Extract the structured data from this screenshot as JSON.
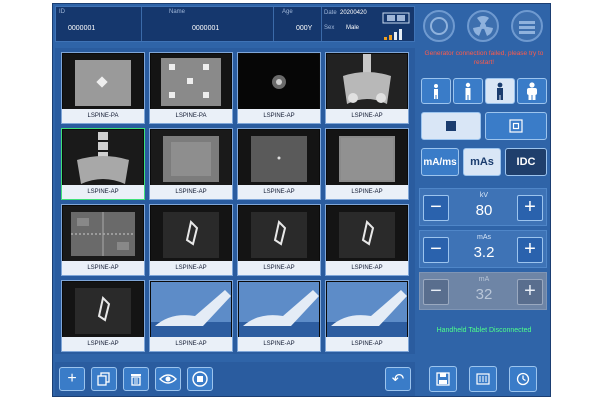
{
  "header": {
    "id_label": "ID",
    "id_value": "0000001",
    "name_label": "Name",
    "name_value": "0000001",
    "age_label": "Age",
    "age_value": "000Y",
    "date_label": "Date",
    "date_value": "20200420",
    "sex_label": "Sex",
    "sex_value": "Male"
  },
  "thumbnails": [
    {
      "caption": "LSPINE-PA"
    },
    {
      "caption": "LSPINE-PA"
    },
    {
      "caption": "LSPINE-AP"
    },
    {
      "caption": "LSPINE-AP"
    },
    {
      "caption": "LSPINE-AP"
    },
    {
      "caption": "LSPINE-AP"
    },
    {
      "caption": "LSPINE-AP"
    },
    {
      "caption": "LSPINE-AP"
    },
    {
      "caption": "LSPINE-AP"
    },
    {
      "caption": "LSPINE-AP"
    },
    {
      "caption": "LSPINE-AP"
    },
    {
      "caption": "LSPINE-AP"
    },
    {
      "caption": "LSPINE-AP"
    },
    {
      "caption": "LSPINE-AP"
    },
    {
      "caption": "LSPINE-AP"
    },
    {
      "caption": "LSPINE-AP"
    }
  ],
  "status": {
    "generator_error": "Generator connection failed, please try to restart!",
    "tablet": "Handheld Tablet Disconnected"
  },
  "mode_buttons": {
    "mams_label": "mA/ms",
    "mas_label": "mAs",
    "idc_label": "IDC"
  },
  "controls": {
    "kv": {
      "label": "kV",
      "value": "80"
    },
    "mas": {
      "label": "mAs",
      "value": "3.2"
    },
    "ma": {
      "label": "mA",
      "value": "32"
    }
  },
  "icons": {
    "add": "plus-icon",
    "copy": "copy-icon",
    "delete": "trash-icon",
    "view": "eye-icon",
    "stop": "stop-icon",
    "undo": "undo-icon",
    "save": "save-icon",
    "film": "film-icon",
    "timer": "timer-icon"
  },
  "colors": {
    "background": "#2f64a8",
    "error": "#ff5a4a",
    "tablet_status": "#4dff8a",
    "selected_border": "#3fe07a"
  }
}
